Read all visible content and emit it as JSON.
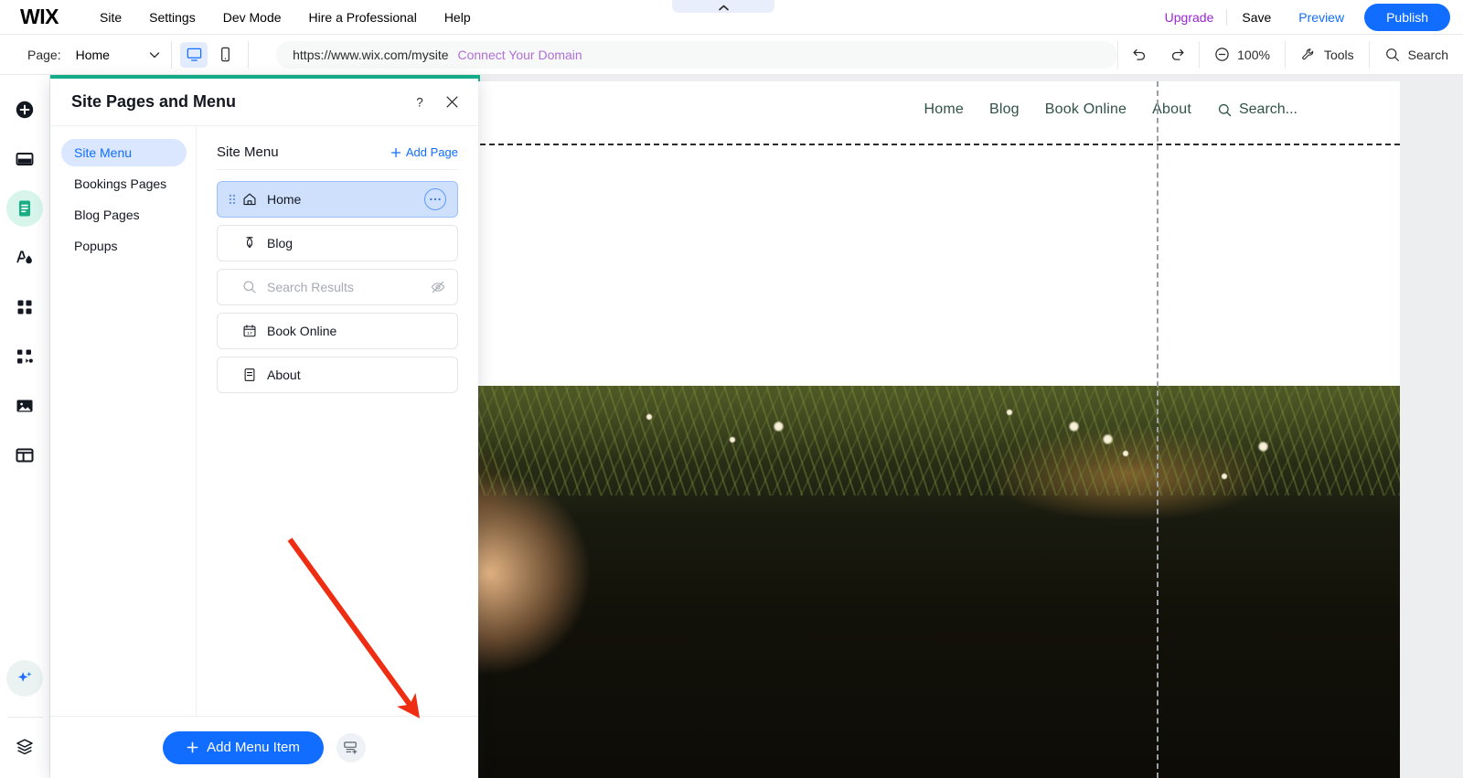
{
  "topbar": {
    "logo": "WIX",
    "menu": [
      {
        "label": "Site"
      },
      {
        "label": "Settings"
      },
      {
        "label": "Dev Mode"
      },
      {
        "label": "Hire a Professional"
      },
      {
        "label": "Help"
      }
    ],
    "upgrade_label": "Upgrade",
    "save_label": "Save",
    "preview_label": "Preview",
    "publish_label": "Publish",
    "publish_color": "#116dff",
    "upgrade_color": "#9a27d5"
  },
  "toolbar": {
    "page_label": "Page:",
    "page_value": "Home",
    "desktop_icon": "desktop-icon",
    "mobile_icon": "mobile-icon",
    "url": "https://www.wix.com/mysite",
    "connect_domain": "Connect Your Domain",
    "undo_icon": "undo-icon",
    "redo_icon": "redo-icon",
    "zoom_value": "100%",
    "tools_label": "Tools",
    "search_label": "Search"
  },
  "leftrail": {
    "items": [
      {
        "icon": "add-elements-icon",
        "active": false
      },
      {
        "icon": "site-sections-icon",
        "active": false
      },
      {
        "icon": "pages-menu-icon",
        "active": true
      },
      {
        "icon": "site-design-icon",
        "active": false
      },
      {
        "icon": "apps-icon",
        "active": false
      },
      {
        "icon": "my-business-icon",
        "active": false
      },
      {
        "icon": "media-icon",
        "active": false
      },
      {
        "icon": "content-manager-icon",
        "active": false
      }
    ],
    "ai_icon": "ai-sparkle-icon",
    "layers_icon": "layers-icon"
  },
  "panel": {
    "title": "Site Pages and Menu",
    "help_icon": "help-icon",
    "close_icon": "close-icon",
    "nav": [
      {
        "label": "Site Menu",
        "active": true
      },
      {
        "label": "Bookings Pages",
        "active": false
      },
      {
        "label": "Blog Pages",
        "active": false
      },
      {
        "label": "Popups",
        "active": false
      }
    ],
    "section_title": "Site Menu",
    "add_page_label": "Add Page",
    "pages": [
      {
        "label": "Home",
        "icon": "home-icon",
        "selected": true,
        "hidden": false,
        "has_more": true
      },
      {
        "label": "Blog",
        "icon": "pen-icon",
        "selected": false,
        "hidden": false,
        "has_more": false
      },
      {
        "label": "Search Results",
        "icon": "search-icon",
        "selected": false,
        "hidden": true,
        "has_more": false
      },
      {
        "label": "Book Online",
        "icon": "calendar-icon",
        "selected": false,
        "hidden": false,
        "has_more": false
      },
      {
        "label": "About",
        "icon": "page-icon",
        "selected": false,
        "hidden": false,
        "has_more": false
      }
    ],
    "add_menu_item_label": "Add Menu Item",
    "footer_icon": "add-dropdown-icon"
  },
  "canvas": {
    "site_nav": [
      {
        "label": "Home"
      },
      {
        "label": "Blog"
      },
      {
        "label": "Book Online"
      },
      {
        "label": "About"
      }
    ],
    "site_search_label": "Search...",
    "site_nav_color": "#2f5248",
    "green_bar_color": "#12b28c"
  }
}
